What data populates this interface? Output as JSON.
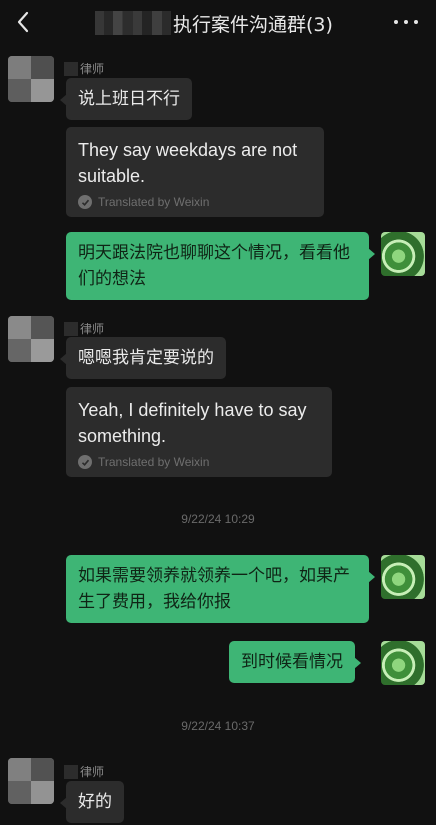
{
  "header": {
    "title": "执行案件沟通群(3)",
    "back_icon": "chevron-left-icon",
    "more_icon": "more-horizontal-icon"
  },
  "messages": [
    {
      "type": "incoming",
      "sender": "律师",
      "text": "说上班日不行",
      "translation": {
        "text": "They say weekdays are not suitable.",
        "label": "Translated by Weixin"
      }
    },
    {
      "type": "outgoing",
      "text": "明天跟法院也聊聊这个情况，看看他们的想法"
    },
    {
      "type": "incoming",
      "sender": "律师",
      "text": "嗯嗯我肯定要说的",
      "translation": {
        "text": "Yeah, I definitely have to say something.",
        "label": "Translated by Weixin"
      }
    },
    {
      "type": "timestamp",
      "text": "9/22/24 10:29"
    },
    {
      "type": "outgoing",
      "text": "如果需要领养就领养一个吧，如果产生了费用，我给你报"
    },
    {
      "type": "outgoing",
      "text": "到时候看情况"
    },
    {
      "type": "timestamp",
      "text": "9/22/24 10:37"
    },
    {
      "type": "incoming",
      "sender": "律师",
      "text": "好的"
    }
  ],
  "colors": {
    "background": "#111111",
    "incoming_bubble": "#2c2c2c",
    "outgoing_bubble": "#3eb575",
    "muted_text": "#6f6f6f"
  }
}
